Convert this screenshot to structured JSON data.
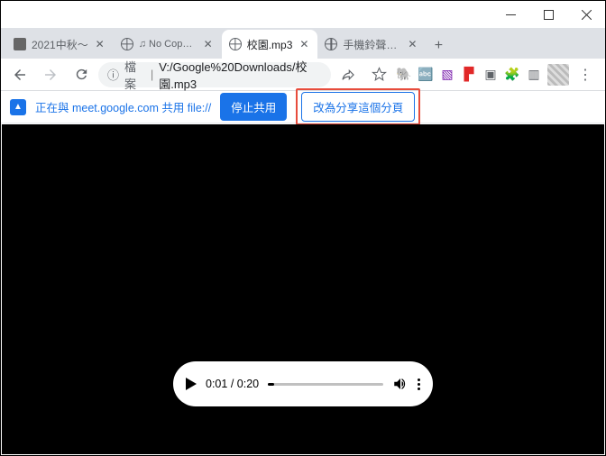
{
  "tabs": [
    {
      "title": "2021中秋～",
      "icon": "meet"
    },
    {
      "title": "No Copyright",
      "icon": "note"
    },
    {
      "title": "校園.mp3",
      "icon": "globe",
      "active": true
    },
    {
      "title": "手機鈴聲_幻化成",
      "icon": "globe"
    }
  ],
  "address": {
    "label": "檔案",
    "path": "V:/Google%20Downloads/校園.mp3"
  },
  "share": {
    "text": "正在與 meet.google.com 共用 file://",
    "stop": "停止共用",
    "change": "改為分享這個分頁"
  },
  "player": {
    "current": "0:01",
    "duration": "0:20"
  }
}
